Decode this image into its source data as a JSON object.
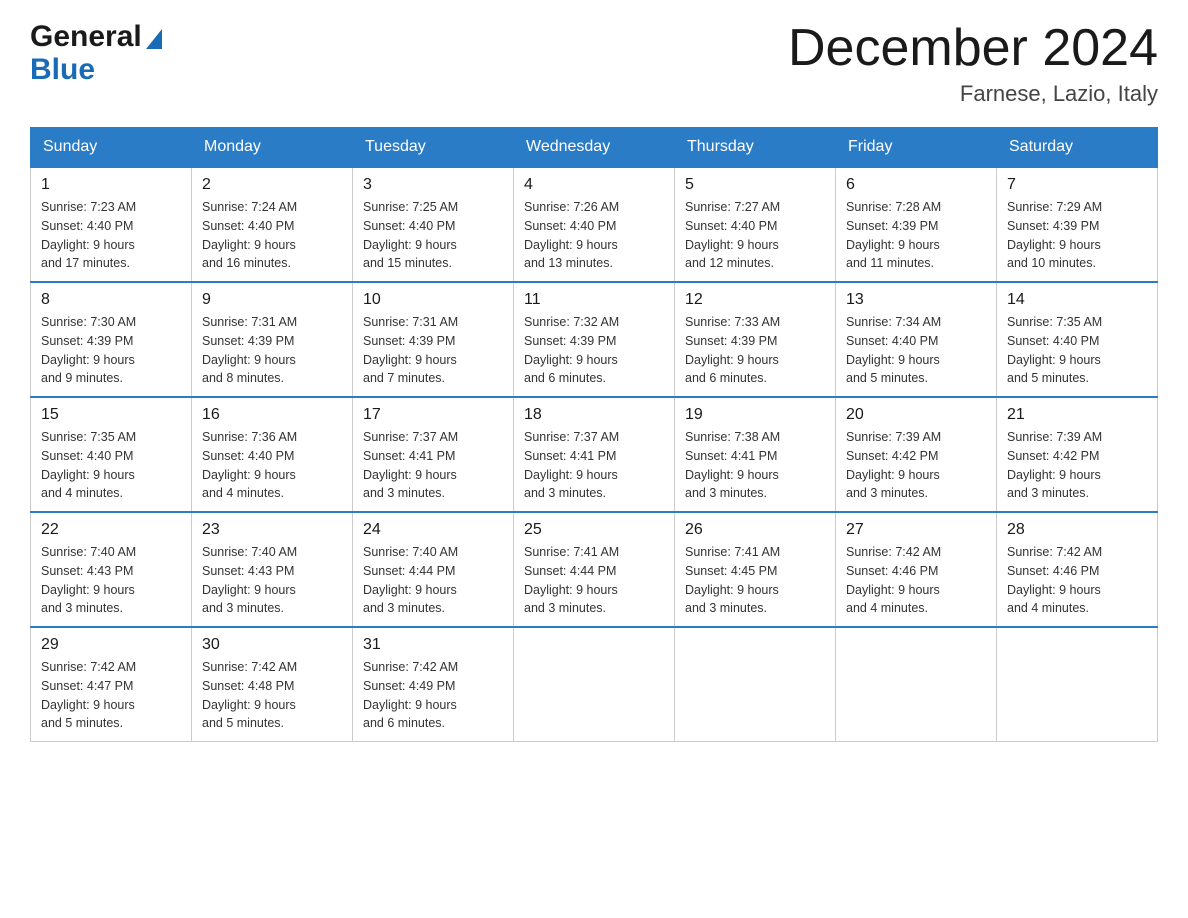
{
  "logo": {
    "general": "General",
    "blue": "Blue"
  },
  "title": "December 2024",
  "subtitle": "Farnese, Lazio, Italy",
  "days_of_week": [
    "Sunday",
    "Monday",
    "Tuesday",
    "Wednesday",
    "Thursday",
    "Friday",
    "Saturday"
  ],
  "weeks": [
    [
      {
        "date": "1",
        "sunrise": "7:23 AM",
        "sunset": "4:40 PM",
        "daylight": "9 hours and 17 minutes."
      },
      {
        "date": "2",
        "sunrise": "7:24 AM",
        "sunset": "4:40 PM",
        "daylight": "9 hours and 16 minutes."
      },
      {
        "date": "3",
        "sunrise": "7:25 AM",
        "sunset": "4:40 PM",
        "daylight": "9 hours and 15 minutes."
      },
      {
        "date": "4",
        "sunrise": "7:26 AM",
        "sunset": "4:40 PM",
        "daylight": "9 hours and 13 minutes."
      },
      {
        "date": "5",
        "sunrise": "7:27 AM",
        "sunset": "4:40 PM",
        "daylight": "9 hours and 12 minutes."
      },
      {
        "date": "6",
        "sunrise": "7:28 AM",
        "sunset": "4:39 PM",
        "daylight": "9 hours and 11 minutes."
      },
      {
        "date": "7",
        "sunrise": "7:29 AM",
        "sunset": "4:39 PM",
        "daylight": "9 hours and 10 minutes."
      }
    ],
    [
      {
        "date": "8",
        "sunrise": "7:30 AM",
        "sunset": "4:39 PM",
        "daylight": "9 hours and 9 minutes."
      },
      {
        "date": "9",
        "sunrise": "7:31 AM",
        "sunset": "4:39 PM",
        "daylight": "9 hours and 8 minutes."
      },
      {
        "date": "10",
        "sunrise": "7:31 AM",
        "sunset": "4:39 PM",
        "daylight": "9 hours and 7 minutes."
      },
      {
        "date": "11",
        "sunrise": "7:32 AM",
        "sunset": "4:39 PM",
        "daylight": "9 hours and 6 minutes."
      },
      {
        "date": "12",
        "sunrise": "7:33 AM",
        "sunset": "4:39 PM",
        "daylight": "9 hours and 6 minutes."
      },
      {
        "date": "13",
        "sunrise": "7:34 AM",
        "sunset": "4:40 PM",
        "daylight": "9 hours and 5 minutes."
      },
      {
        "date": "14",
        "sunrise": "7:35 AM",
        "sunset": "4:40 PM",
        "daylight": "9 hours and 5 minutes."
      }
    ],
    [
      {
        "date": "15",
        "sunrise": "7:35 AM",
        "sunset": "4:40 PM",
        "daylight": "9 hours and 4 minutes."
      },
      {
        "date": "16",
        "sunrise": "7:36 AM",
        "sunset": "4:40 PM",
        "daylight": "9 hours and 4 minutes."
      },
      {
        "date": "17",
        "sunrise": "7:37 AM",
        "sunset": "4:41 PM",
        "daylight": "9 hours and 3 minutes."
      },
      {
        "date": "18",
        "sunrise": "7:37 AM",
        "sunset": "4:41 PM",
        "daylight": "9 hours and 3 minutes."
      },
      {
        "date": "19",
        "sunrise": "7:38 AM",
        "sunset": "4:41 PM",
        "daylight": "9 hours and 3 minutes."
      },
      {
        "date": "20",
        "sunrise": "7:39 AM",
        "sunset": "4:42 PM",
        "daylight": "9 hours and 3 minutes."
      },
      {
        "date": "21",
        "sunrise": "7:39 AM",
        "sunset": "4:42 PM",
        "daylight": "9 hours and 3 minutes."
      }
    ],
    [
      {
        "date": "22",
        "sunrise": "7:40 AM",
        "sunset": "4:43 PM",
        "daylight": "9 hours and 3 minutes."
      },
      {
        "date": "23",
        "sunrise": "7:40 AM",
        "sunset": "4:43 PM",
        "daylight": "9 hours and 3 minutes."
      },
      {
        "date": "24",
        "sunrise": "7:40 AM",
        "sunset": "4:44 PM",
        "daylight": "9 hours and 3 minutes."
      },
      {
        "date": "25",
        "sunrise": "7:41 AM",
        "sunset": "4:44 PM",
        "daylight": "9 hours and 3 minutes."
      },
      {
        "date": "26",
        "sunrise": "7:41 AM",
        "sunset": "4:45 PM",
        "daylight": "9 hours and 3 minutes."
      },
      {
        "date": "27",
        "sunrise": "7:42 AM",
        "sunset": "4:46 PM",
        "daylight": "9 hours and 4 minutes."
      },
      {
        "date": "28",
        "sunrise": "7:42 AM",
        "sunset": "4:46 PM",
        "daylight": "9 hours and 4 minutes."
      }
    ],
    [
      {
        "date": "29",
        "sunrise": "7:42 AM",
        "sunset": "4:47 PM",
        "daylight": "9 hours and 5 minutes."
      },
      {
        "date": "30",
        "sunrise": "7:42 AM",
        "sunset": "4:48 PM",
        "daylight": "9 hours and 5 minutes."
      },
      {
        "date": "31",
        "sunrise": "7:42 AM",
        "sunset": "4:49 PM",
        "daylight": "9 hours and 6 minutes."
      },
      {
        "date": "",
        "sunrise": "",
        "sunset": "",
        "daylight": ""
      },
      {
        "date": "",
        "sunrise": "",
        "sunset": "",
        "daylight": ""
      },
      {
        "date": "",
        "sunrise": "",
        "sunset": "",
        "daylight": ""
      },
      {
        "date": "",
        "sunrise": "",
        "sunset": "",
        "daylight": ""
      }
    ]
  ],
  "labels": {
    "sunrise_prefix": "Sunrise: ",
    "sunset_prefix": "Sunset: ",
    "daylight_prefix": "Daylight: "
  }
}
